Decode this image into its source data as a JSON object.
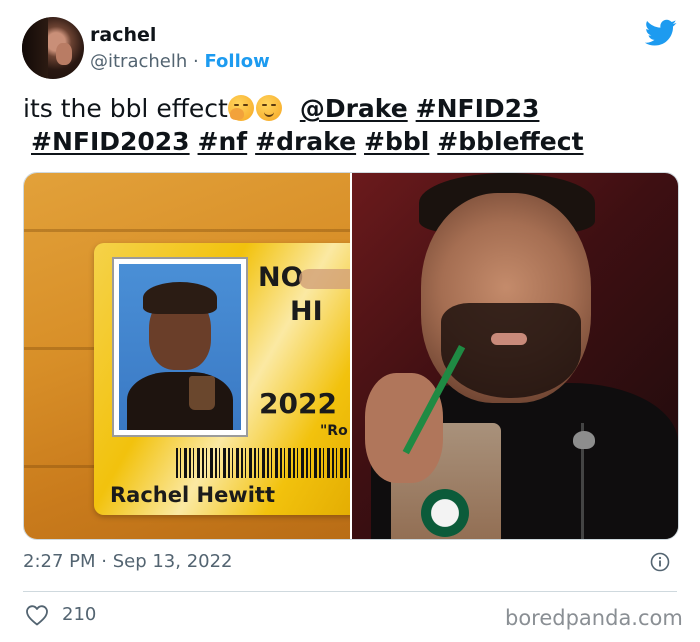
{
  "user": {
    "name": "rachel",
    "handle": "@itrachelh",
    "separator": "·",
    "follow_label": "Follow"
  },
  "tweet": {
    "text_lead": "its the bbl effect",
    "emojis": [
      "face-with-hand-over-mouth-emoji",
      "smirking-face-emoji"
    ],
    "mention": "@Drake",
    "hashtags": [
      "#NFID23",
      "#NFID2023",
      "#nf",
      "#drake",
      "#bbl",
      "#bbleffect"
    ]
  },
  "media": {
    "id_card": {
      "school_line1": "NO",
      "school_line2": "HI",
      "year": "2022",
      "quote": "\"Ro",
      "name": "Rachel Hewitt"
    }
  },
  "footer": {
    "timestamp": "2:27 PM · Sep 13, 2022",
    "like_count": "210"
  },
  "watermark": "boredpanda.com",
  "colors": {
    "accent": "#1d9bf0",
    "muted": "#536471",
    "text": "#0f1419"
  }
}
